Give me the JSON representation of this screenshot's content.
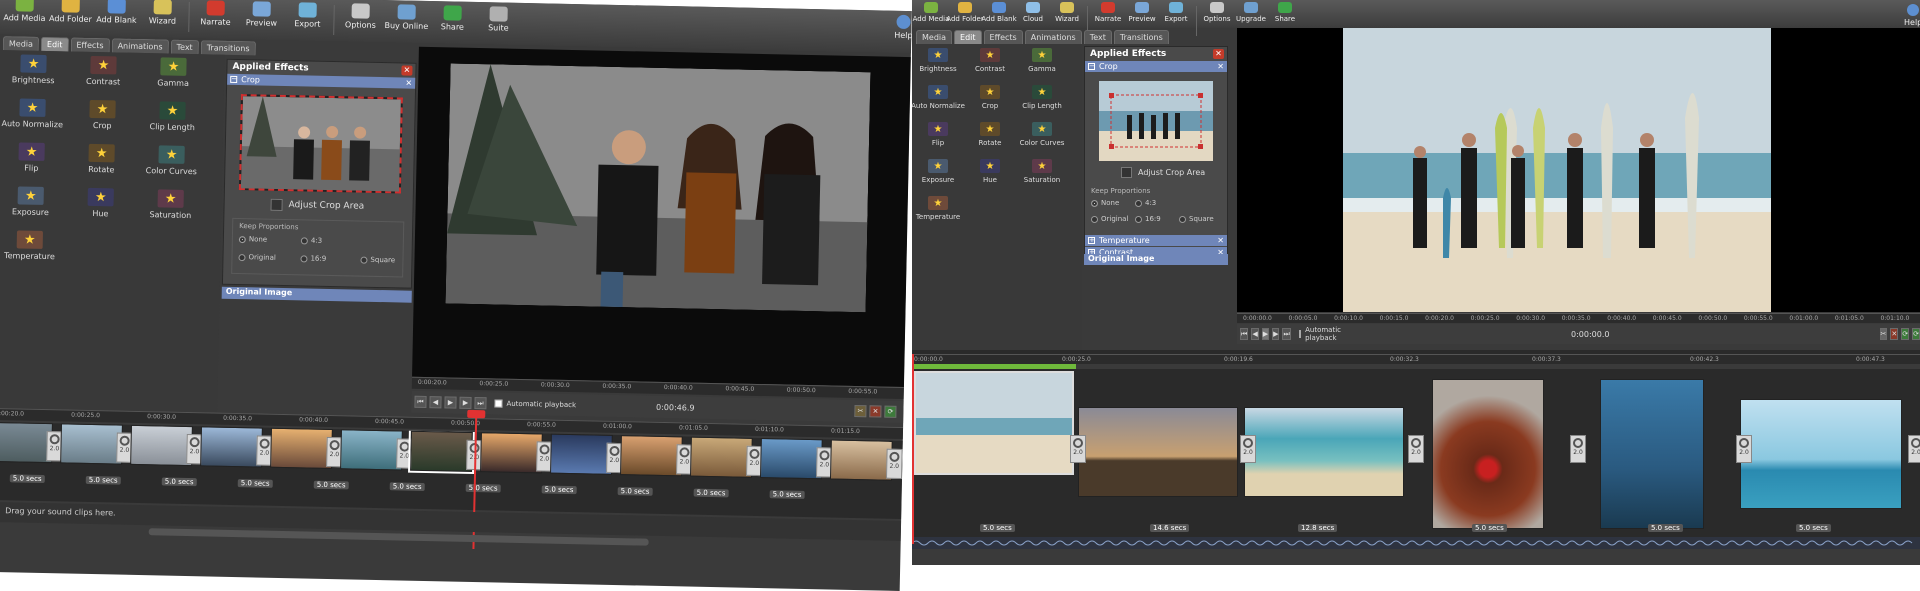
{
  "left": {
    "toolbar": [
      {
        "label": "Add Media",
        "icon": "add-media-icon",
        "color": "#7bb241"
      },
      {
        "label": "Add Folder",
        "icon": "add-folder-icon",
        "color": "#e0b341"
      },
      {
        "label": "Add Blank",
        "icon": "add-blank-icon",
        "color": "#5b8fd6"
      },
      {
        "label": "Wizard",
        "icon": "wizard-icon",
        "color": "#d8c25a"
      },
      {
        "label": "Narrate",
        "icon": "narrate-icon",
        "color": "#d23b2e"
      },
      {
        "label": "Preview",
        "icon": "preview-icon",
        "color": "#7aa7d8"
      },
      {
        "label": "Export",
        "icon": "export-icon",
        "color": "#6fb2d8"
      },
      {
        "label": "Options",
        "icon": "options-icon",
        "color": "#c8c8c8"
      },
      {
        "label": "Buy Online",
        "icon": "buy-online-icon",
        "color": "#6fa0d0"
      },
      {
        "label": "Share",
        "icon": "share-icon",
        "color": "#3fa64a"
      },
      {
        "label": "Suite",
        "icon": "suite-icon",
        "color": "#b0b0b0"
      }
    ],
    "help": "Help",
    "tabs": [
      "Media",
      "Edit",
      "Effects",
      "Animations",
      "Text",
      "Transitions"
    ],
    "active_tab": "Edit",
    "effects": [
      "Brightness",
      "Contrast",
      "Gamma",
      "Auto Normalize",
      "Crop",
      "Clip Length",
      "Flip",
      "Rotate",
      "Color Curves",
      "Exposure",
      "Hue",
      "Saturation",
      "Temperature"
    ],
    "panel": {
      "title": "Applied Effects",
      "section": "Crop",
      "adjust": "Adjust Crop Area",
      "keep": "Keep Proportions",
      "opts": [
        "None",
        "4:3",
        "Original",
        "16:9",
        "Square"
      ],
      "original": "Original Image"
    },
    "timecode": "0:00:46.9",
    "autoplay": "Automatic playback",
    "ruler": [
      "0:00:20.0",
      "0:00:25.0",
      "0:00:30.0",
      "0:00:35.0",
      "0:00:40.0",
      "0:00:45.0",
      "0:00:50.0",
      "0:00:55.0",
      "0:01:00.0",
      "0:01:05.0",
      "0:01:10.0",
      "0:01:15.0"
    ],
    "durs": [
      "5.0 secs",
      "5.0 secs",
      "5.0 secs",
      "5.0 secs",
      "5.0 secs",
      "5.0 secs",
      "5.0 secs",
      "5.0 secs",
      "5.0 secs",
      "5.0 secs",
      "5.0 secs"
    ],
    "trans_label": "2.0",
    "sound_hint": "Drag your sound clips here."
  },
  "right": {
    "toolbar": [
      {
        "label": "Add Media",
        "icon": "add-media-icon",
        "color": "#7bb241"
      },
      {
        "label": "Add Folder",
        "icon": "add-folder-icon",
        "color": "#e0b341"
      },
      {
        "label": "Add Blank",
        "icon": "add-blank-icon",
        "color": "#5b8fd6"
      },
      {
        "label": "Cloud",
        "icon": "cloud-icon",
        "color": "#8fbfe8"
      },
      {
        "label": "Wizard",
        "icon": "wizard-icon",
        "color": "#d8c25a"
      },
      {
        "label": "Narrate",
        "icon": "narrate-icon",
        "color": "#d23b2e"
      },
      {
        "label": "Preview",
        "icon": "preview-icon",
        "color": "#7aa7d8"
      },
      {
        "label": "Export",
        "icon": "export-icon",
        "color": "#6fb2d8"
      },
      {
        "label": "Options",
        "icon": "options-icon",
        "color": "#c8c8c8"
      },
      {
        "label": "Upgrade",
        "icon": "upgrade-icon",
        "color": "#6fa0d0"
      },
      {
        "label": "Share",
        "icon": "share-icon",
        "color": "#3fa64a"
      }
    ],
    "help": "Help",
    "tabs": [
      "Media",
      "Edit",
      "Effects",
      "Animations",
      "Text",
      "Transitions"
    ],
    "active_tab": "Edit",
    "effects": [
      "Brightness",
      "Contrast",
      "Gamma",
      "Auto Normalize",
      "Crop",
      "Clip Length",
      "Flip",
      "Rotate",
      "Color Curves",
      "Exposure",
      "Hue",
      "Saturation",
      "Temperature"
    ],
    "panel": {
      "title": "Applied Effects",
      "section": "Crop",
      "adjust": "Adjust Crop Area",
      "keep": "Keep Proportions",
      "opts": [
        "None",
        "4:3",
        "Original",
        "16:9",
        "Square"
      ],
      "collapsed": [
        "Temperature",
        "Contrast"
      ],
      "original": "Original Image"
    },
    "timecode": "0:00:00.0",
    "autoplay": "Automatic playback",
    "ruler": [
      "0:00:00.0",
      "0:00:05.0",
      "0:00:10.0",
      "0:00:15.0",
      "0:00:20.0",
      "0:00:25.0",
      "0:00:30.0",
      "0:00:35.0",
      "0:00:40.0",
      "0:00:45.0",
      "0:00:50.0",
      "0:00:55.0",
      "0:01:00.0",
      "0:01:05.0",
      "0:01:10.0"
    ],
    "tl_ruler": [
      "0:00:00.0",
      "0:00:25.0",
      "0:00:19.6",
      "0:00:32.3",
      "0:00:37.3",
      "0:00:42.3",
      "0:00:47.3"
    ],
    "durs": [
      "5.0 secs",
      "14.6 secs",
      "12.8 secs",
      "5.0 secs",
      "5.0 secs",
      "5.0 secs"
    ],
    "trans_label": "2.0"
  }
}
